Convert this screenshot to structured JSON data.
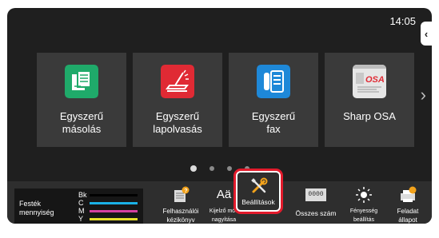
{
  "status": {
    "time": "14:05"
  },
  "side_tab": {
    "glyph": "‹"
  },
  "tiles": [
    {
      "line1": "Egyszerű",
      "line2": "másolás",
      "icon": "copy-icon",
      "color": "#1faa6a"
    },
    {
      "line1": "Egyszerű",
      "line2": "lapolvasás",
      "icon": "scan-icon",
      "color": "#e02a34"
    },
    {
      "line1": "Egyszerű",
      "line2": "fax",
      "icon": "fax-icon",
      "color": "#1e88d8"
    },
    {
      "line1": "Sharp OSA",
      "line2": "",
      "icon": "sharp-osa-icon",
      "color": "#e6e6e6"
    }
  ],
  "pager": {
    "pages": 4,
    "active": 1,
    "next_glyph": "›"
  },
  "toner": {
    "line1": "Festék",
    "line2": "mennyiség",
    "levels": [
      {
        "letter": "Bk",
        "color": "#000000"
      },
      {
        "letter": "C",
        "color": "#1ab1e6"
      },
      {
        "letter": "M",
        "color": "#d43fa0"
      },
      {
        "letter": "Y",
        "color": "#e7df2b"
      }
    ]
  },
  "bottom_bar": {
    "manual": {
      "line1": "Felhasználói",
      "line2": "kézikönyv",
      "icon": "manual-icon"
    },
    "zoom": {
      "line1": "Kijelző mód",
      "line2": "nagyítása",
      "icon": "font-size-icon",
      "glyph": "Aä"
    },
    "settings": {
      "label": "Beállítások",
      "icon": "wrench-screwdriver-icon"
    },
    "total": {
      "label": "Összes szám",
      "icon": "counter-icon",
      "glyph": "0000"
    },
    "brightness": {
      "line1": "Fényesség",
      "line2": "beállítás",
      "icon": "brightness-icon"
    },
    "status": {
      "line1": "Feladat",
      "line2": "állapot",
      "icon": "job-status-icon"
    }
  }
}
